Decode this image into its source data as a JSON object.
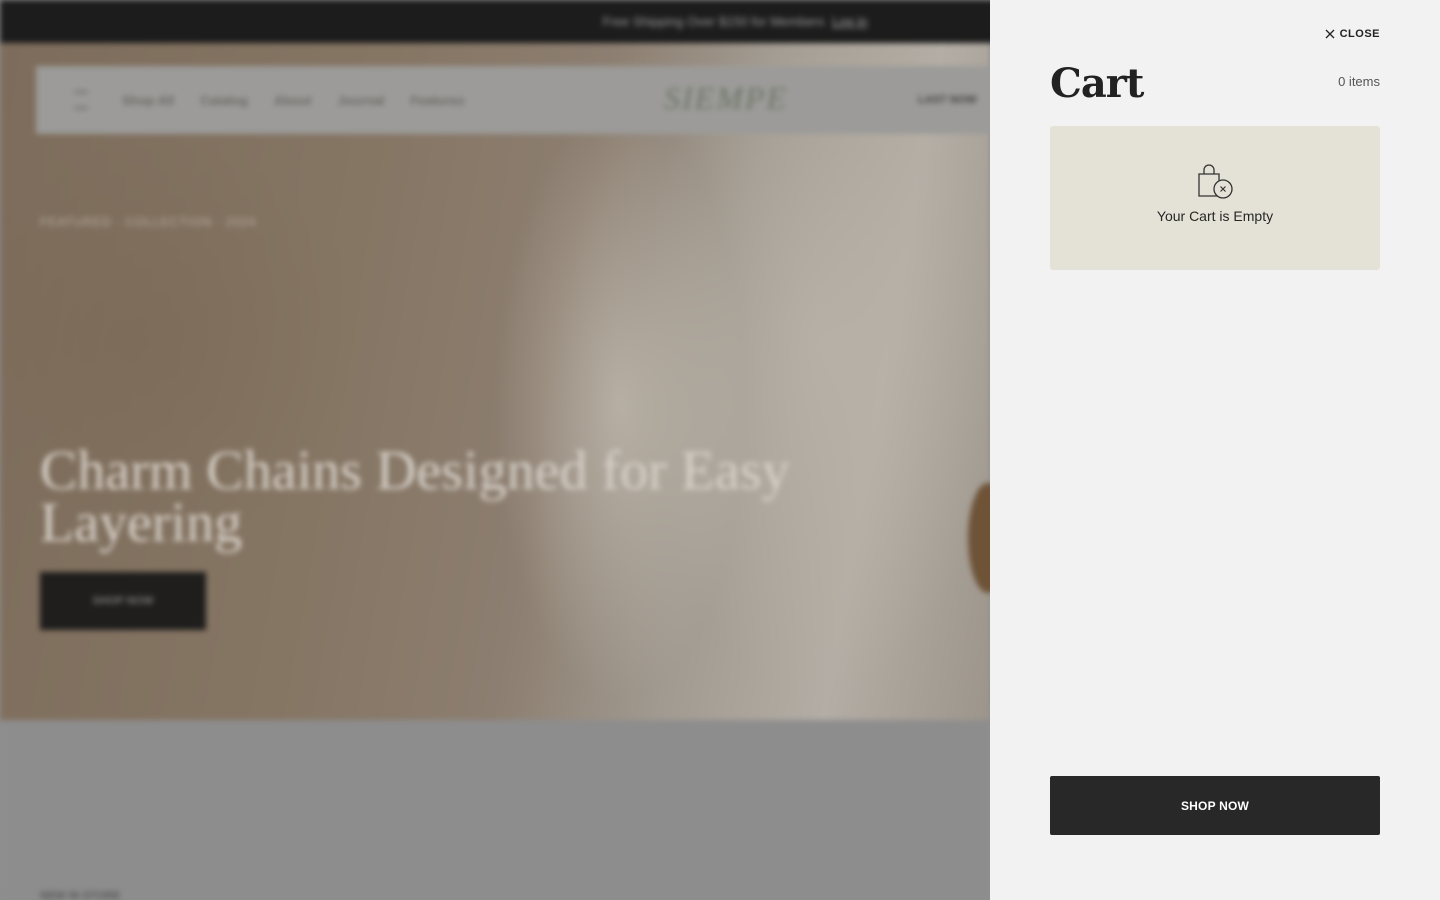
{
  "background": {
    "announcement": {
      "text": "Free Shipping Over $150 for Members",
      "link": "Log in"
    },
    "nav": {
      "links": [
        "Shop All",
        "Catalog",
        "About",
        "Journal",
        "Features"
      ],
      "logo": "SIEMPE",
      "cta": "LAST NOW"
    },
    "breadcrumb": "FEATURED  ·  COLLECTION  ·  2024",
    "hero": {
      "title": "Charm Chains Designed for Easy Layering",
      "button": "SHOP NOW"
    },
    "lower_label": "NEW IN STORE"
  },
  "cart": {
    "close_label": "CLOSE",
    "title": "Cart",
    "count": "0 items",
    "empty_message": "Your Cart is Empty",
    "shop_button": "SHOP NOW"
  }
}
